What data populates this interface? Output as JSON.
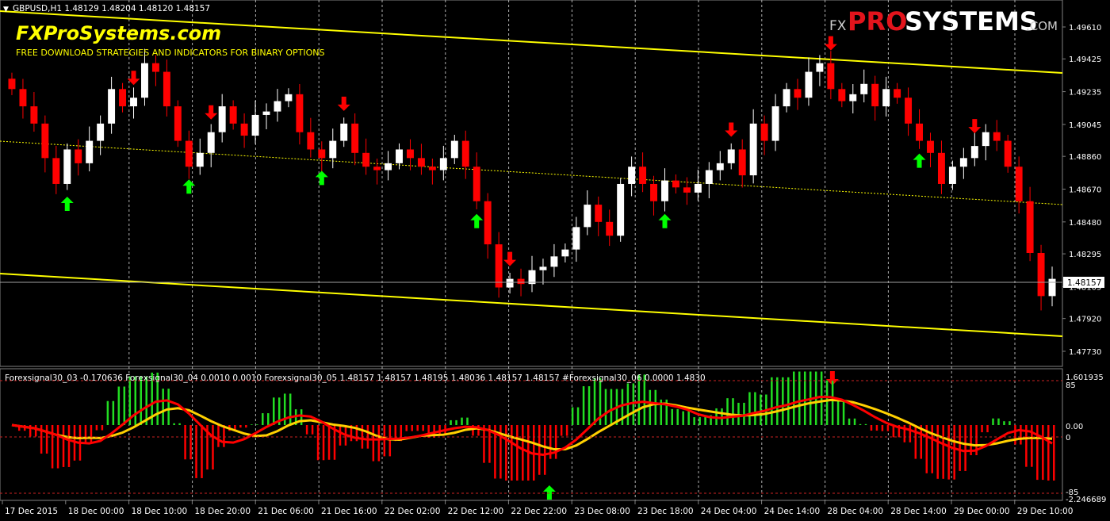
{
  "symbol_header": "GBPUSD,H1  1.48129 1.48204 1.48120 1.48157",
  "watermark": {
    "site": "FXProSystems.com",
    "tagline": "FREE DOWNLOAD STRATEGIES AND INDICATORS FOR BINARY OPTIONS",
    "logo_fx": "FX",
    "logo_pro": "PRO",
    "logo_systems": "SYSTEMS",
    "logo_com": ".COM"
  },
  "indicator_header": "Forexsignal30_03 -0.170636  Forexsignal30_04 0.0010 0.0010  Forexsignal30_05 1.48157 1.48157 1.48195 1.48036 1.48157 1.48157  #Forexsignal30_06 0.0000 1.4830",
  "price_axis": [
    "1.49610",
    "1.49425",
    "1.49235",
    "1.49045",
    "1.48860",
    "1.48670",
    "1.48480",
    "1.48295",
    "1.48105",
    "1.47920",
    "1.47730"
  ],
  "current_price": "1.48157",
  "osc_axis": {
    "top_value": "1.601935",
    "top_level": "85",
    "mid_value": "0.00",
    "mid_level": "0",
    "bottom_level": "-85",
    "bottom_value": "-2.246689"
  },
  "time_axis": [
    "17 Dec 2015",
    "18 Dec 00:00",
    "18 Dec 10:00",
    "18 Dec 20:00",
    "21 Dec 06:00",
    "21 Dec 16:00",
    "22 Dec 02:00",
    "22 Dec 12:00",
    "22 Dec 22:00",
    "23 Dec 08:00",
    "23 Dec 18:00",
    "24 Dec 04:00",
    "24 Dec 14:00",
    "28 Dec 04:00",
    "28 Dec 14:00",
    "29 Dec 00:00",
    "29 Dec 10:00"
  ],
  "colors": {
    "bull": "#ffffff",
    "bear": "#ff0000",
    "channel": "#ffff00",
    "up_arrow": "#00ff00",
    "down_arrow": "#ff0000",
    "hist_pos": "#22dd22",
    "hist_neg": "#ff0000",
    "signal": "#ffd000",
    "osc_line": "#ff0000"
  },
  "chart_data": {
    "type": "candlestick",
    "price_ylim": [
      1.4773,
      1.4961
    ],
    "candles_close": [
      1.4925,
      1.4915,
      1.4905,
      1.4885,
      1.487,
      1.489,
      1.4882,
      1.4895,
      1.4905,
      1.4925,
      1.4915,
      1.492,
      1.494,
      1.4935,
      1.4915,
      1.4895,
      1.488,
      1.4888,
      1.49,
      1.4915,
      1.4905,
      1.4898,
      1.491,
      1.4912,
      1.4918,
      1.4922,
      1.49,
      1.489,
      1.4885,
      1.4895,
      1.4905,
      1.4888,
      1.488,
      1.4878,
      1.4882,
      1.489,
      1.4885,
      1.488,
      1.4878,
      1.4885,
      1.4895,
      1.488,
      1.486,
      1.4835,
      1.481,
      1.4815,
      1.4812,
      1.482,
      1.4822,
      1.4828,
      1.4832,
      1.4845,
      1.4858,
      1.4848,
      1.484,
      1.487,
      1.488,
      1.487,
      1.486,
      1.4872,
      1.4868,
      1.4865,
      1.487,
      1.4878,
      1.4882,
      1.489,
      1.4875,
      1.4905,
      1.4895,
      1.4915,
      1.4925,
      1.492,
      1.4935,
      1.494,
      1.4925,
      1.4918,
      1.4922,
      1.4928,
      1.4915,
      1.4925,
      1.492,
      1.4905,
      1.4895,
      1.4888,
      1.487,
      1.488,
      1.4885,
      1.4892,
      1.49,
      1.4895,
      1.488,
      1.486,
      1.483,
      1.4805,
      1.4815
    ],
    "down_signals_idx": [
      11,
      18,
      30,
      45,
      65,
      74,
      87
    ],
    "up_signals_idx": [
      5,
      16,
      28,
      42,
      59,
      82
    ]
  }
}
